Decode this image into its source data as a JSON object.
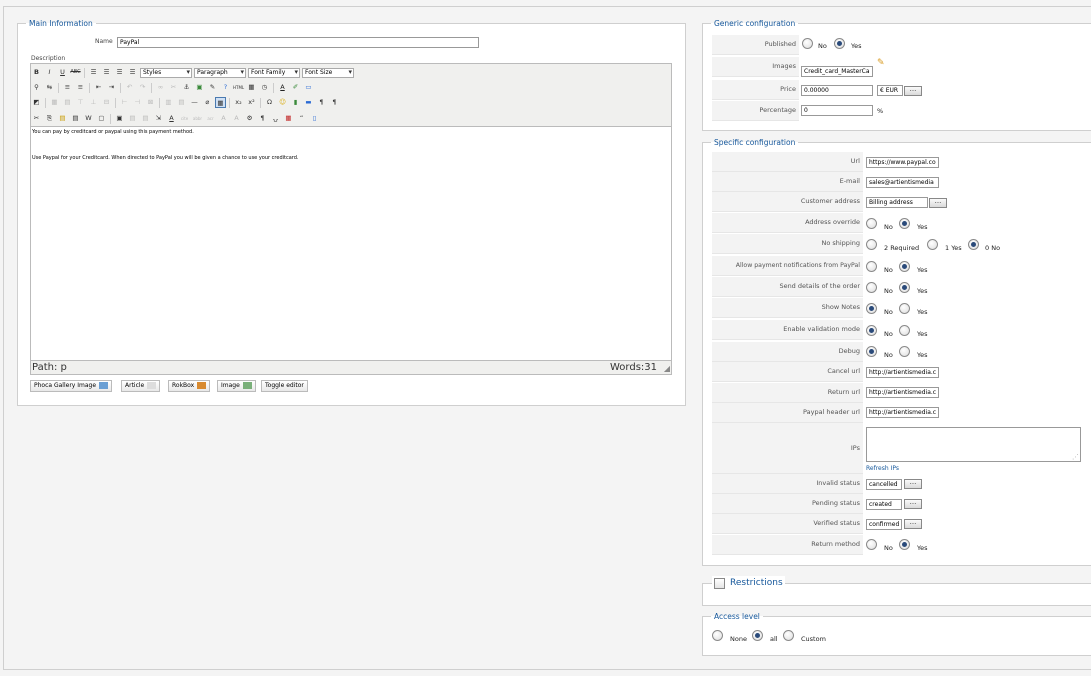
{
  "main": {
    "legend": "Main Information",
    "name_label": "Name",
    "name_value": "PayPal",
    "description_label": "Description",
    "toolbar": {
      "styles": "Styles",
      "paragraph": "Paragraph",
      "font_family": "Font Family",
      "font_size": "Font Size"
    },
    "editor": {
      "line1": "You can pay by creditcard or paypal using this payment method.",
      "line2": "Use Paypal for your Creditcard. When directed to PayPal you will be given a chance to use your creditcard.",
      "path": "Path: p",
      "words": "Words:31"
    },
    "buttons": {
      "phoca": "Phoca Gallery Image",
      "article": "Article",
      "rokbox": "RokBox",
      "image": "Image",
      "toggle": "Toggle editor"
    }
  },
  "generic": {
    "legend": "Generic configuration",
    "published_label": "Published",
    "no": "No",
    "yes": "Yes",
    "images_label": "Images",
    "images_value": "Credit_card_MasterCard",
    "price_label": "Price",
    "price_value": "0.00000",
    "currency_value": "€ EUR",
    "percentage_label": "Percentage",
    "percentage_value": "0",
    "percent_sign": "%",
    "picker": "..."
  },
  "specific": {
    "legend": "Specific configuration",
    "url_label": "Url",
    "url_value": "https://www.paypal.com",
    "email_label": "E-mail",
    "email_value": "sales@artientismedia",
    "customer_address_label": "Customer address",
    "customer_address_value": "Billing address",
    "address_override_label": "Address override",
    "no_shipping_label": "No shipping",
    "ship_2": "2 Required",
    "ship_1": "1 Yes",
    "ship_0": "0 No",
    "allow_notif_label": "Allow payment notifications from PayPal",
    "send_details_label": "Send details of the order",
    "show_notes_label": "Show Notes",
    "enable_validation_label": "Enable validation mode",
    "debug_label": "Debug",
    "cancel_url_label": "Cancel url",
    "cancel_url_value": "http://artientismedia.c",
    "return_url_label": "Return url",
    "return_url_value": "http://artientismedia.c",
    "paypal_header_label": "Paypal header url",
    "paypal_header_value": "http://artientismedia.c",
    "ips_label": "IPs",
    "refresh_ips": "Refresh IPs",
    "invalid_status_label": "Invalid status",
    "invalid_status_value": "cancelled",
    "pending_status_label": "Pending status",
    "pending_status_value": "created",
    "verified_status_label": "Verified status",
    "verified_status_value": "confirmed",
    "return_method_label": "Return method",
    "no": "No",
    "yes": "Yes",
    "picker": "..."
  },
  "restrictions": {
    "label": "Restrictions"
  },
  "access": {
    "legend": "Access level",
    "none": "None",
    "all": "all",
    "custom": "Custom"
  }
}
